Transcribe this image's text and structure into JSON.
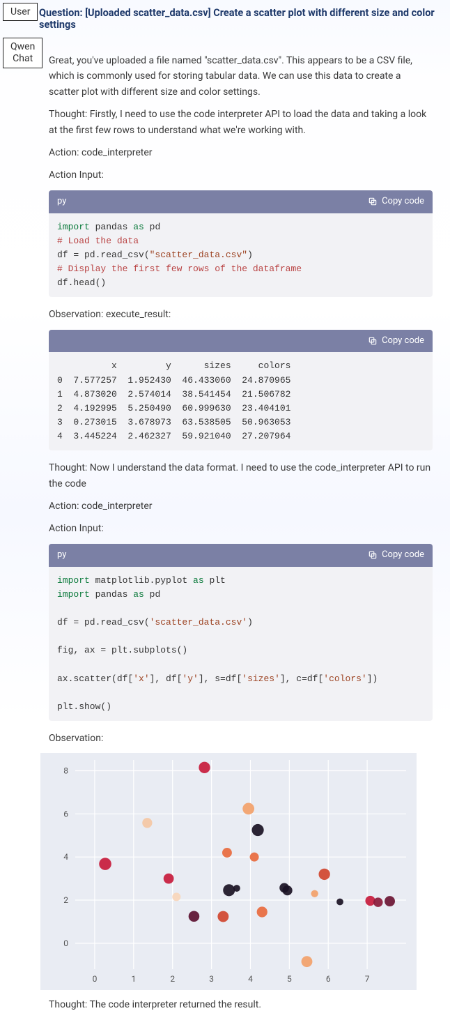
{
  "roles": {
    "user": "User",
    "bot_line1": "Qwen",
    "bot_line2": "Chat"
  },
  "question": "Question: [Uploaded scatter_data.csv] Create a scatter plot with different size and color settings",
  "intro_p1": "Great, you've uploaded a file named \"scatter_data.csv\". This appears to be a CSV file, which is commonly used for storing tabular data. We can use this data to create a scatter plot with different size and color settings.",
  "thought1": "Thought: Firstly, I need to use the code interpreter API to load the data and taking a look at the first few rows to understand what we're working with.",
  "action_label": "Action: code_interpreter",
  "action_input_label": "Action Input:",
  "observation1_label": "Observation: execute_result:",
  "observation2_label": "Observation:",
  "thought2": "Thought: Now I understand the data format. I need to use the code_interpreter API to run the code",
  "thought3": "Thought: The code interpreter returned the result.",
  "code_lang": "py",
  "copy_label": "Copy code",
  "code1": {
    "l1a": "import",
    "l1b": " pandas ",
    "l1c": "as",
    "l1d": " pd",
    "l2": "# Load the data",
    "l3a": "df = pd.read_csv(",
    "l3b": "\"scatter_data.csv\"",
    "l3c": ")",
    "l4": "# Display the first few rows of the dataframe",
    "l5": "df.head()"
  },
  "table_output": "          x         y      sizes     colors\n0  7.577257  1.952430  46.433060  24.870965\n1  4.873020  2.574014  38.541454  21.506782\n2  4.192995  5.250490  60.999630  23.404101\n3  0.273015  3.678973  63.538505  50.963053\n4  3.445224  2.462327  59.921040  27.207964",
  "code2": {
    "l1a": "import",
    "l1b": " matplotlib.pyplot ",
    "l1c": "as",
    "l1d": " plt",
    "l2a": "import",
    "l2b": " pandas ",
    "l2c": "as",
    "l2d": " pd",
    "l3a": "df = pd.read_csv(",
    "l3b": "'scatter_data.csv'",
    "l3c": ")",
    "l4": "fig, ax = plt.subplots()",
    "l5a": "ax.scatter(df[",
    "l5b": "'x'",
    "l5c": "], df[",
    "l5d": "'y'",
    "l5e": "], s=df[",
    "l5f": "'sizes'",
    "l5g": "], c=df[",
    "l5h": "'colors'",
    "l5i": "])",
    "l6": "plt.show()"
  },
  "chart_data": {
    "type": "scatter",
    "xlabel": "",
    "ylabel": "",
    "xticks": [
      0,
      1,
      2,
      3,
      4,
      5,
      6,
      7
    ],
    "yticks": [
      0,
      2,
      4,
      6,
      8
    ],
    "xlim": [
      -0.5,
      8.0
    ],
    "ylim": [
      -1.2,
      8.5
    ],
    "points": [
      {
        "x": 7.58,
        "y": 1.95,
        "size": 46,
        "color": "#6b1533"
      },
      {
        "x": 4.87,
        "y": 2.57,
        "size": 39,
        "color": "#1a1224"
      },
      {
        "x": 4.19,
        "y": 5.25,
        "size": 61,
        "color": "#1a1224"
      },
      {
        "x": 0.27,
        "y": 3.68,
        "size": 64,
        "color": "#c71b3c"
      },
      {
        "x": 3.45,
        "y": 2.46,
        "size": 60,
        "color": "#1a1224"
      },
      {
        "x": 2.82,
        "y": 8.15,
        "size": 55,
        "color": "#c71b3c"
      },
      {
        "x": 3.95,
        "y": 6.24,
        "size": 58,
        "color": "#f2a16a"
      },
      {
        "x": 1.35,
        "y": 5.58,
        "size": 42,
        "color": "#f4c7a4"
      },
      {
        "x": 2.1,
        "y": 2.15,
        "size": 30,
        "color": "#f7d6bb"
      },
      {
        "x": 2.55,
        "y": 1.25,
        "size": 50,
        "color": "#5c1131"
      },
      {
        "x": 3.3,
        "y": 1.24,
        "size": 52,
        "color": "#d0452f"
      },
      {
        "x": 4.3,
        "y": 1.45,
        "size": 48,
        "color": "#e86a3e"
      },
      {
        "x": 3.65,
        "y": 2.55,
        "size": 20,
        "color": "#1a1224"
      },
      {
        "x": 4.1,
        "y": 4.0,
        "size": 35,
        "color": "#e86a3e"
      },
      {
        "x": 4.95,
        "y": 2.45,
        "size": 42,
        "color": "#1a1224"
      },
      {
        "x": 3.4,
        "y": 4.2,
        "size": 40,
        "color": "#e86a3e"
      },
      {
        "x": 6.3,
        "y": 1.92,
        "size": 20,
        "color": "#1a1224"
      },
      {
        "x": 7.08,
        "y": 1.97,
        "size": 42,
        "color": "#c71b3c"
      },
      {
        "x": 7.28,
        "y": 1.9,
        "size": 38,
        "color": "#8a1a3a"
      },
      {
        "x": 5.9,
        "y": 3.2,
        "size": 55,
        "color": "#d0452f"
      },
      {
        "x": 5.65,
        "y": 2.3,
        "size": 22,
        "color": "#f2a16a"
      },
      {
        "x": 1.9,
        "y": 3.0,
        "size": 45,
        "color": "#c71b3c"
      },
      {
        "x": 5.45,
        "y": -0.85,
        "size": 52,
        "color": "#f2a16a"
      }
    ]
  }
}
